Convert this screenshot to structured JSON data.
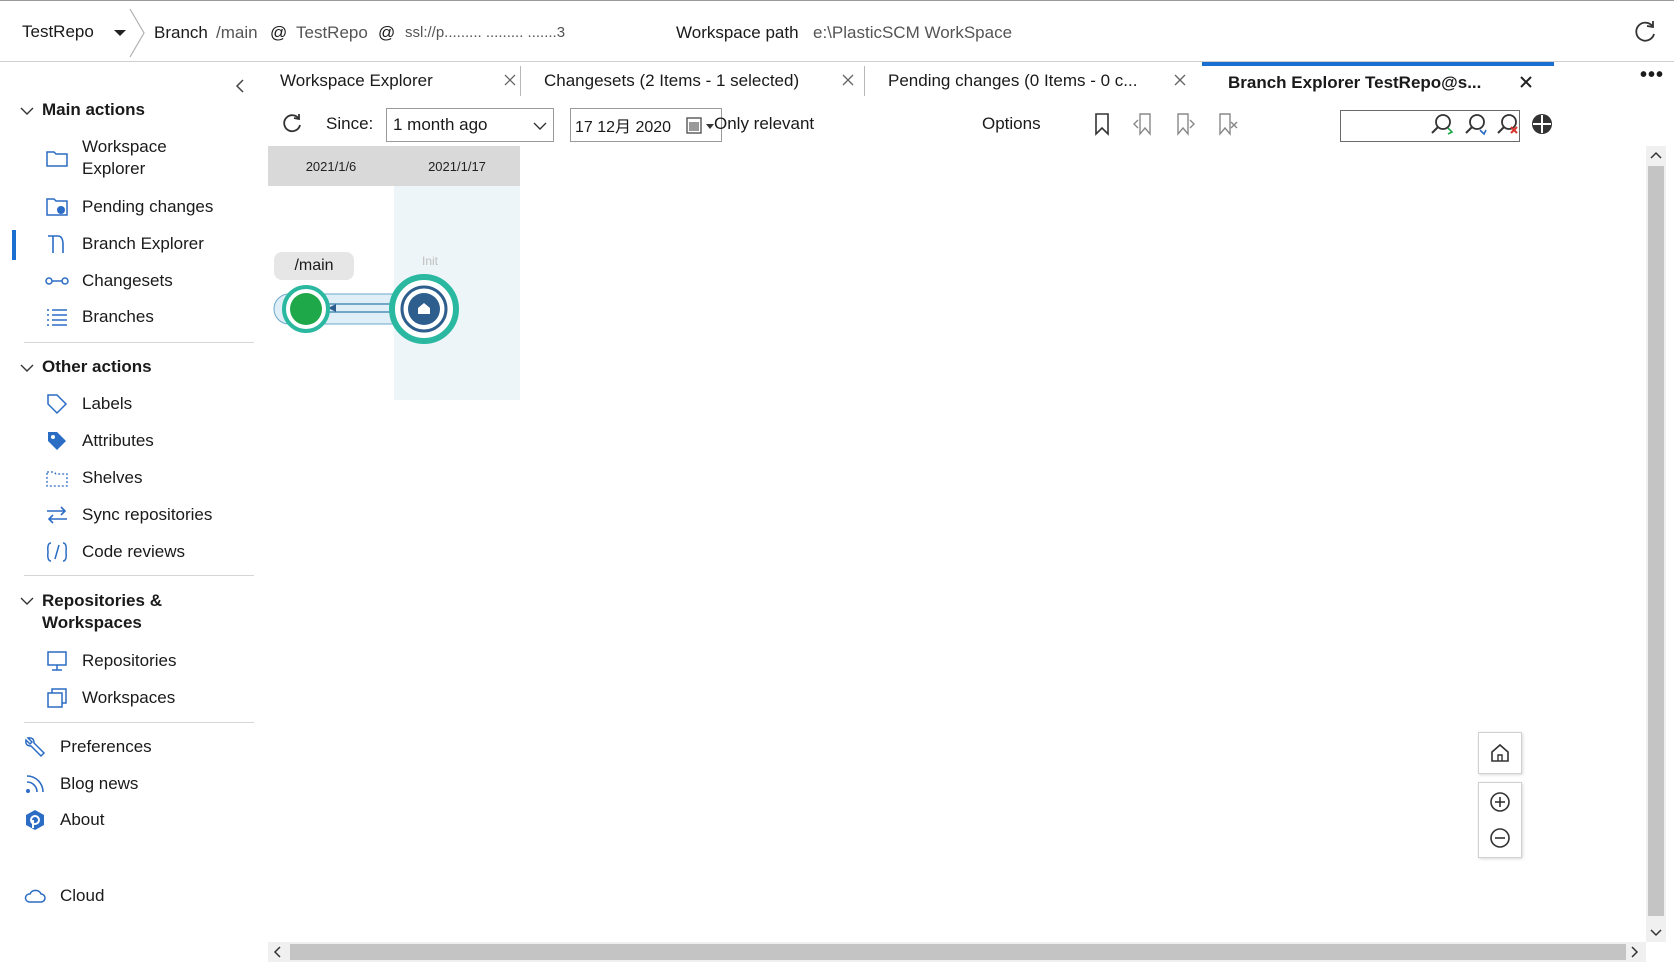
{
  "topbar": {
    "repo": "TestRepo",
    "branch_label": "Branch",
    "branch_value": "/main",
    "at1": "@",
    "repo_value": "TestRepo",
    "at2": "@",
    "server": "ssl://p.........  .........  .......3",
    "workspace_label": "Workspace path",
    "workspace_value": "e:\\PlasticSCM WorkSpace"
  },
  "sidebar": {
    "main_actions": "Main actions",
    "items_main": [
      {
        "label": "Workspace",
        "label2": "Explorer"
      },
      {
        "label": "Pending changes"
      },
      {
        "label": "Branch Explorer"
      },
      {
        "label": "Changesets"
      },
      {
        "label": "Branches"
      }
    ],
    "other_actions": "Other actions",
    "items_other": [
      {
        "label": "Labels"
      },
      {
        "label": "Attributes"
      },
      {
        "label": "Shelves"
      },
      {
        "label": "Sync repositories"
      },
      {
        "label": "Code reviews"
      }
    ],
    "repos_head1": "Repositories &",
    "repos_head2": "Workspaces",
    "items_repos": [
      {
        "label": "Repositories"
      },
      {
        "label": "Workspaces"
      }
    ],
    "items_bottom": [
      {
        "label": "Preferences"
      },
      {
        "label": "Blog news"
      },
      {
        "label": "About"
      },
      {
        "label": "Cloud"
      }
    ]
  },
  "tabs": [
    {
      "label": "Workspace Explorer"
    },
    {
      "label": "Changesets (2 Items - 1 selected)"
    },
    {
      "label": "Pending changes (0 Items - 0 c..."
    },
    {
      "label": "Branch Explorer TestRepo@s..."
    }
  ],
  "more_label": "•••",
  "toolbar": {
    "since_label": "Since:",
    "since_value": "1 month ago",
    "date_value": "17 12月 2020",
    "only_relevant": "Only relevant",
    "options": "Options"
  },
  "explorer": {
    "dates": [
      "2021/1/6",
      "2021/1/17"
    ],
    "branch": "/main",
    "changeset_label": "Init"
  },
  "colors": {
    "accent": "#1a6fd1",
    "node_green": "#1fa84a",
    "node_teal": "#2ab8a0",
    "node_blue": "#2d5e8e"
  }
}
